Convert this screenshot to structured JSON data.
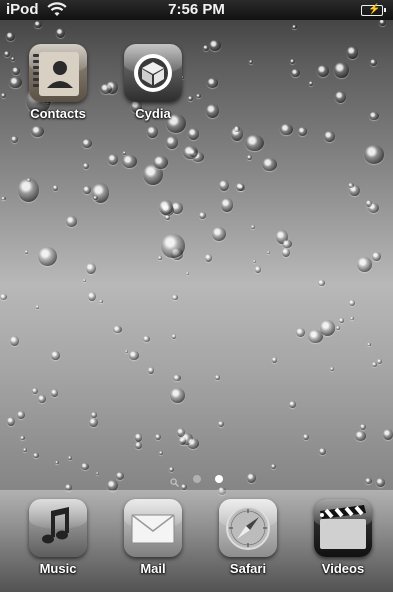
{
  "status_bar": {
    "carrier": "iPod",
    "time": "7:56 PM"
  },
  "home": {
    "apps": [
      {
        "label": "Contacts",
        "icon": "contacts-icon"
      },
      {
        "label": "Cydia",
        "icon": "cydia-icon"
      }
    ]
  },
  "page_indicator": {
    "pages": 2,
    "current": 2,
    "has_search": true
  },
  "dock": {
    "apps": [
      {
        "label": "Music",
        "icon": "music-icon"
      },
      {
        "label": "Mail",
        "icon": "mail-icon"
      },
      {
        "label": "Safari",
        "icon": "safari-icon"
      },
      {
        "label": "Videos",
        "icon": "videos-icon"
      }
    ]
  }
}
